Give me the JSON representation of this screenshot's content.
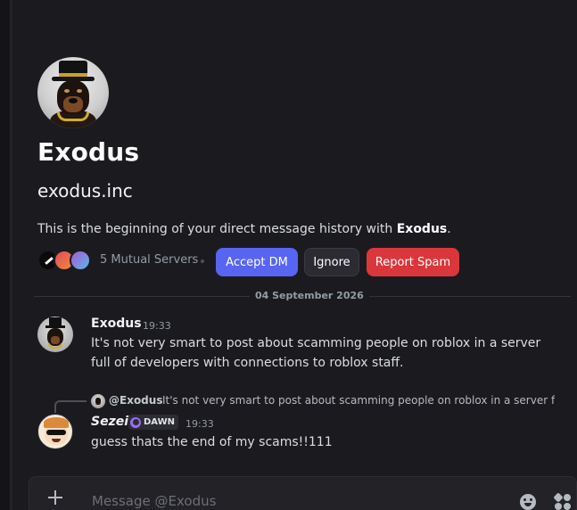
{
  "profile": {
    "display_name": "Exodus",
    "username": "exodus.inc",
    "intro_prefix": "This is the beginning of your direct message history with ",
    "intro_name": "Exodus",
    "intro_suffix": ".",
    "mutual_servers": "5 Mutual Servers"
  },
  "actions": {
    "accept": "Accept DM",
    "ignore": "Ignore",
    "report": "Report Spam"
  },
  "divider_date": "04 September 2026",
  "messages": [
    {
      "author": "Exodus",
      "time": "19:33",
      "text": "It's not very smart to post about scamming people on roblox in a server full of developers with connections to roblox staff."
    },
    {
      "author": "Sezei",
      "tag": "DAWN",
      "time": "19:33",
      "text": "guess thats the end of my scams!!111",
      "reply": {
        "author": "@Exodus",
        "text": "It's not very smart to post about scamming people on roblox in a server f..."
      }
    }
  ],
  "composer": {
    "placeholder": "Message @Exodus"
  },
  "icons": {
    "attach": "plus-icon",
    "emoji": "emoji-icon",
    "apps": "apps-icon"
  },
  "colors": {
    "background": "#1b1b1f",
    "accept": "#5865f2",
    "report": "#da373c",
    "tag_icon": "#9b6cf6"
  }
}
